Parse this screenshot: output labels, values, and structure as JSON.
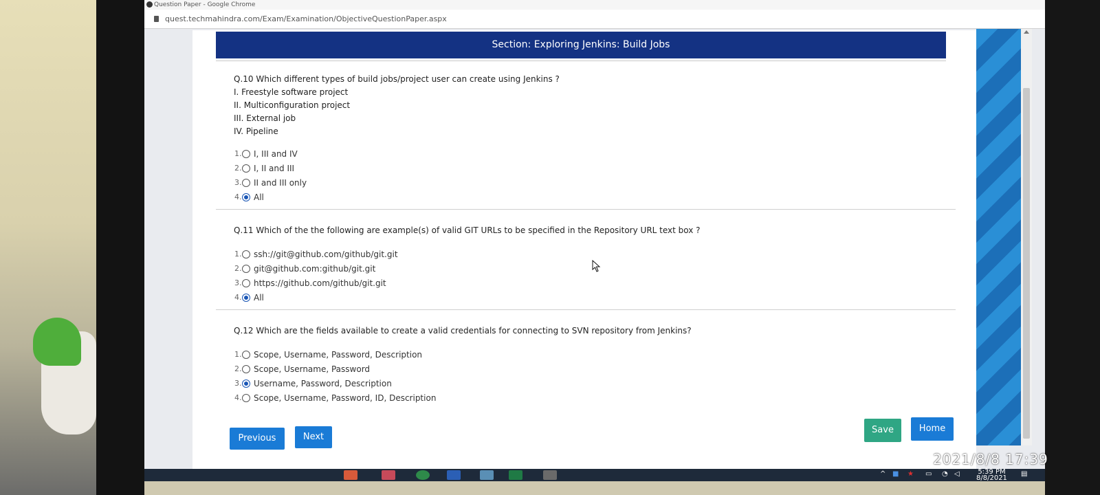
{
  "browser": {
    "window_title": "Question Paper - Google Chrome",
    "url": "quest.techmahindra.com/Exam/Examination/ObjectiveQuestionPaper.aspx"
  },
  "section": {
    "title": "Section: Exploring Jenkins: Build Jobs"
  },
  "questions": [
    {
      "text": "Q.10 Which different types of build jobs/project user can create using Jenkins ?",
      "statements": [
        "I. Freestyle software project",
        "II. Multiconfiguration project",
        "III. External job",
        "IV. Pipeline"
      ],
      "options": [
        {
          "num": "1.",
          "label": "I, III and IV",
          "selected": false
        },
        {
          "num": "2.",
          "label": "I, II and III",
          "selected": false
        },
        {
          "num": "3.",
          "label": "II and III only",
          "selected": false
        },
        {
          "num": "4.",
          "label": "All",
          "selected": true
        }
      ]
    },
    {
      "text": "Q.11 Which of the the following are example(s) of valid GIT URLs to be specified in the Repository URL text box ?",
      "statements": [],
      "options": [
        {
          "num": "1.",
          "label": "ssh://git@github.com/github/git.git",
          "selected": false
        },
        {
          "num": "2.",
          "label": "git@github.com:github/git.git",
          "selected": false
        },
        {
          "num": "3.",
          "label": "https://github.com/github/git.git",
          "selected": false
        },
        {
          "num": "4.",
          "label": "All",
          "selected": true
        }
      ]
    },
    {
      "text": "Q.12 Which are the fields available to create a valid credentials for connecting to SVN repository from Jenkins?",
      "statements": [],
      "options": [
        {
          "num": "1.",
          "label": "Scope, Username, Password, Description",
          "selected": false
        },
        {
          "num": "2.",
          "label": "Scope, Username, Password",
          "selected": false
        },
        {
          "num": "3.",
          "label": "Username, Password, Description",
          "selected": true
        },
        {
          "num": "4.",
          "label": "Scope, Username, Password, ID, Description",
          "selected": false
        }
      ]
    }
  ],
  "buttons": {
    "previous": "Previous",
    "next": "Next",
    "save": "Save",
    "home": "Home"
  },
  "taskbar": {
    "time": "5:39 PM",
    "date": "8/8/2021"
  },
  "photo_timestamp": "2021/8/8 17:39",
  "colors": {
    "banner": "#143283",
    "button_blue": "#1a7bd6",
    "button_green": "#2fa684",
    "radio_selected": "#1a56b5"
  }
}
